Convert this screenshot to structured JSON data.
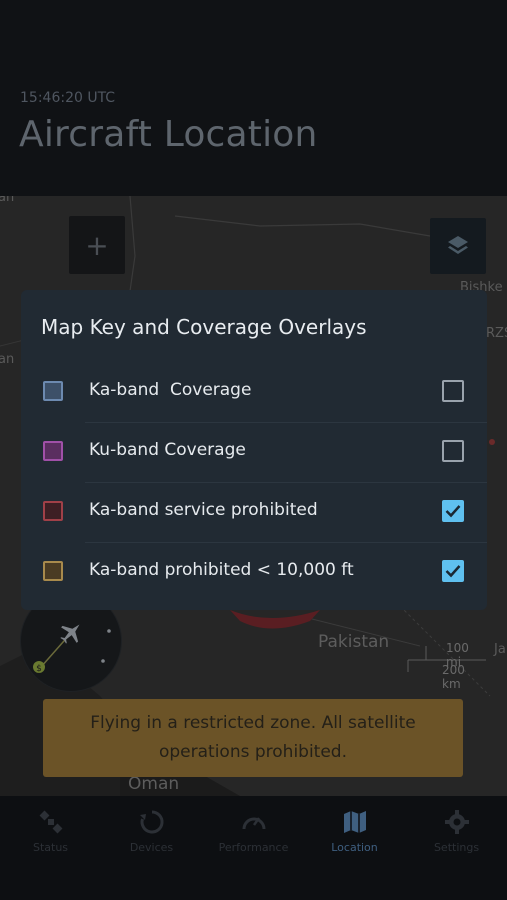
{
  "header": {
    "timestamp": "15:46:20 UTC",
    "title": "Aircraft Location"
  },
  "map": {
    "labels": {
      "pakistan": "Pakistan",
      "oman": "Oman",
      "bishkek": "Bishke",
      "kyrgyz": "RZS",
      "jaipur": "Ja",
      "left_an1": "an",
      "left_an2": "an"
    },
    "scale": {
      "miles": "100 mi",
      "km": "200 km"
    },
    "compass_badge": "$"
  },
  "modal": {
    "title": "Map Key and Coverage Overlays",
    "items": [
      {
        "label": "Ka-band  Coverage",
        "checked": false,
        "swatch_fill": "#3d5068",
        "swatch_border": "#6d8ab0"
      },
      {
        "label": "Ku-band Coverage",
        "checked": false,
        "swatch_fill": "#5a2e60",
        "swatch_border": "#a050a8"
      },
      {
        "label": "Ka-band service prohibited",
        "checked": true,
        "swatch_fill": "#3d1f24",
        "swatch_border": "#a04048"
      },
      {
        "label": "Ka-band prohibited < 10,000 ft",
        "checked": true,
        "swatch_fill": "#4a3b23",
        "swatch_border": "#a88a4c"
      }
    ]
  },
  "alert": {
    "text": "Flying in a restricted zone. All satellite operations prohibited."
  },
  "tabs": [
    {
      "label": "Status",
      "icon": "satellite-icon",
      "active": false
    },
    {
      "label": "Devices",
      "icon": "refresh-icon",
      "active": false
    },
    {
      "label": "Performance",
      "icon": "gauge-icon",
      "active": false
    },
    {
      "label": "Location",
      "icon": "map-icon",
      "active": true
    },
    {
      "label": "Settings",
      "icon": "gear-icon",
      "active": false
    }
  ],
  "colors": {
    "accent": "#5fc0ef",
    "alert_bg": "#6b5327",
    "modal_bg": "#212a33",
    "active_tab": "#3f5f80"
  }
}
